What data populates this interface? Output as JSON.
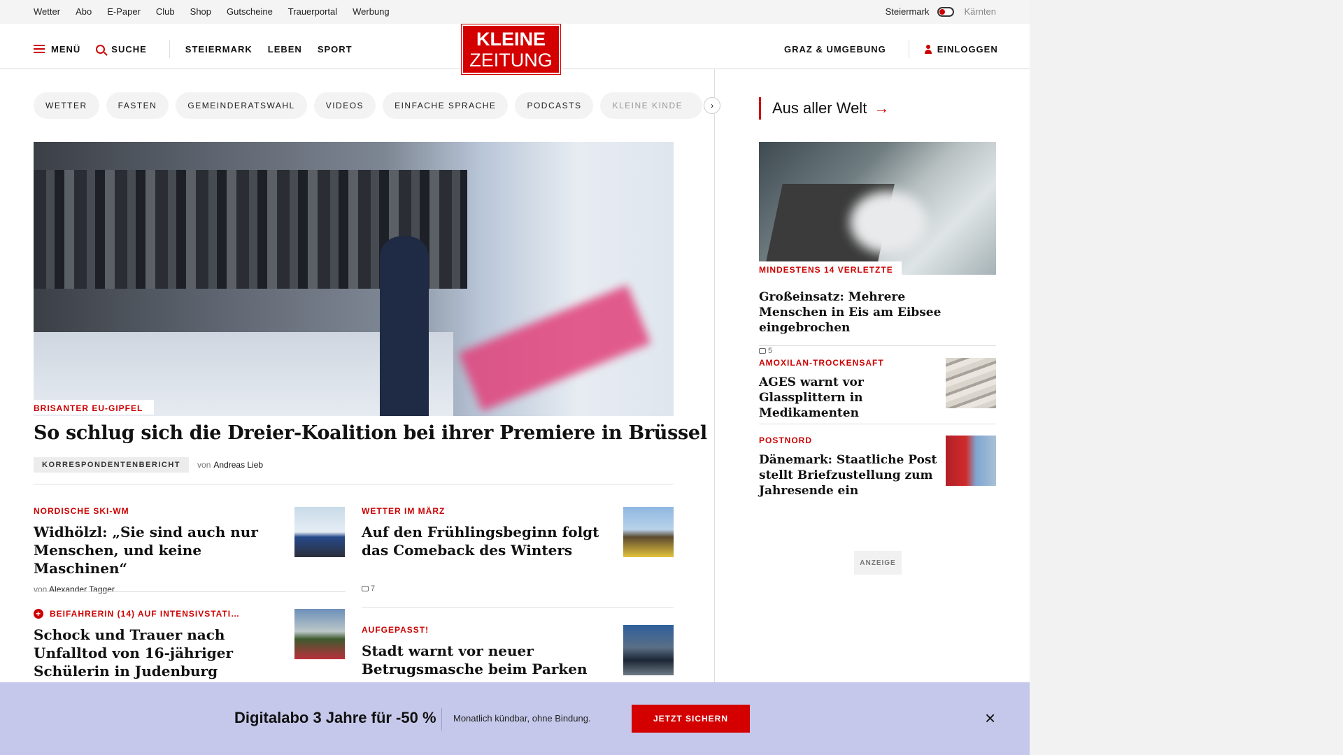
{
  "utility": {
    "links": [
      "Wetter",
      "Abo",
      "E-Paper",
      "Club",
      "Shop",
      "Gutscheine",
      "Trauerportal",
      "Werbung"
    ],
    "region_left": "Steiermark",
    "region_right": "Kärnten"
  },
  "header": {
    "menu_label": "MENÜ",
    "search_label": "SUCHE",
    "nav": [
      "STEIERMARK",
      "LEBEN",
      "SPORT"
    ],
    "logo_line1": "KLEINE",
    "logo_line2": "ZEITUNG",
    "local_label": "GRAZ & UMGEBUNG",
    "login_label": "EINLOGGEN"
  },
  "chips": [
    "WETTER",
    "FASTEN",
    "GEMEINDERATSWAHL",
    "VIDEOS",
    "EINFACHE SPRACHE",
    "PODCASTS",
    "KLEINE KINDE"
  ],
  "chips_next": "›",
  "hero": {
    "kicker": "BRISANTER EU-GIPFEL",
    "title": "So schlug sich die Dreier-Koalition bei ihrer Premiere in Brüssel",
    "badge": "KORRESPONDENTENBERICHT",
    "von": "von",
    "author": "Andreas Lieb"
  },
  "articles": [
    {
      "kicker": "NORDISCHE SKI-WM",
      "title": "Widhölzl: „Sie sind auch nur Menschen, und keine Maschinen“",
      "von": "von",
      "author": "Alexander Tagger"
    },
    {
      "kicker": "WETTER IM MÄRZ",
      "title": "Auf den Frühlingsbeginn folgt das Comeback des Winters",
      "comments": "7"
    },
    {
      "kicker": "BEIFAHRERIN (14) AUF INTENSIVSTATI…",
      "plus": "+",
      "title": "Schock und Trauer nach Unfalltod von 16-jähriger Schülerin in Judenburg"
    },
    {
      "kicker": "AUFGEPASST!",
      "title": "Stadt warnt vor neuer Betrugsmasche beim Parken"
    }
  ],
  "sidebar": {
    "heading": "Aus aller Welt",
    "arrow": "→",
    "lead": {
      "kicker": "MINDESTENS 14 VERLETZTE",
      "title": "Großeinsatz: Mehrere Menschen in Eis am Eibsee eingebrochen",
      "comments": "5"
    },
    "items": [
      {
        "kicker": "AMOXILAN-TROCKENSAFT",
        "title": "AGES warnt vor Glassplittern in Medikamenten"
      },
      {
        "kicker": "POSTNORD",
        "title": "Dänemark: Staatliche Post stellt Briefzustellung zum Jahresende ein"
      }
    ],
    "ad_label": "ANZEIGE"
  },
  "promo": {
    "title": "Digitalabo 3 Jahre für -50 %",
    "subtitle": "Monatlich kündbar, ohne Bindung.",
    "button": "JETZT SICHERN",
    "close": "×"
  },
  "colors": {
    "accent": "#d40000",
    "promo_bg": "#c5c8ea",
    "gutter": "#f2f2f2"
  }
}
